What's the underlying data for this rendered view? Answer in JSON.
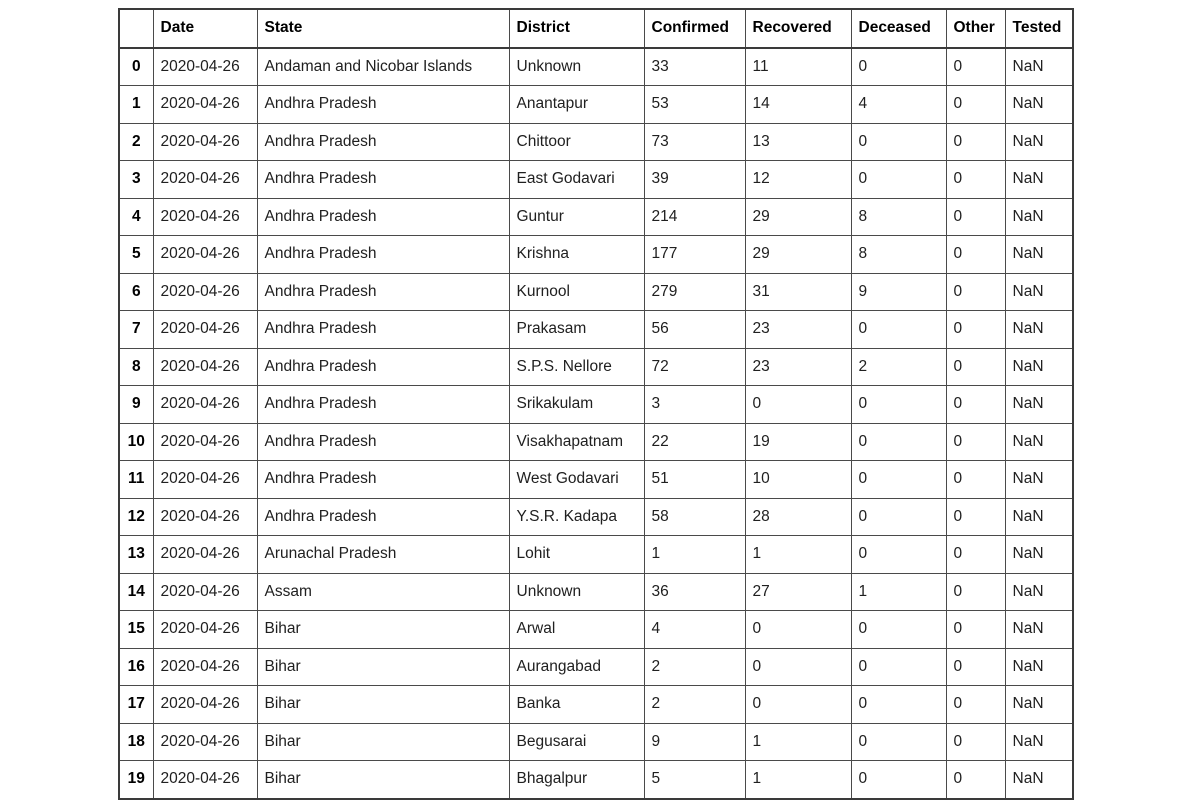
{
  "table": {
    "index_header": "",
    "columns": [
      "Date",
      "State",
      "District",
      "Confirmed",
      "Recovered",
      "Deceased",
      "Other",
      "Tested"
    ],
    "rows": [
      {
        "index": "0",
        "Date": "2020-04-26",
        "State": "Andaman and Nicobar Islands",
        "District": "Unknown",
        "Confirmed": "33",
        "Recovered": "11",
        "Deceased": "0",
        "Other": "0",
        "Tested": "NaN"
      },
      {
        "index": "1",
        "Date": "2020-04-26",
        "State": "Andhra Pradesh",
        "District": "Anantapur",
        "Confirmed": "53",
        "Recovered": "14",
        "Deceased": "4",
        "Other": "0",
        "Tested": "NaN"
      },
      {
        "index": "2",
        "Date": "2020-04-26",
        "State": "Andhra Pradesh",
        "District": "Chittoor",
        "Confirmed": "73",
        "Recovered": "13",
        "Deceased": "0",
        "Other": "0",
        "Tested": "NaN"
      },
      {
        "index": "3",
        "Date": "2020-04-26",
        "State": "Andhra Pradesh",
        "District": "East Godavari",
        "Confirmed": "39",
        "Recovered": "12",
        "Deceased": "0",
        "Other": "0",
        "Tested": "NaN"
      },
      {
        "index": "4",
        "Date": "2020-04-26",
        "State": "Andhra Pradesh",
        "District": "Guntur",
        "Confirmed": "214",
        "Recovered": "29",
        "Deceased": "8",
        "Other": "0",
        "Tested": "NaN"
      },
      {
        "index": "5",
        "Date": "2020-04-26",
        "State": "Andhra Pradesh",
        "District": "Krishna",
        "Confirmed": "177",
        "Recovered": "29",
        "Deceased": "8",
        "Other": "0",
        "Tested": "NaN"
      },
      {
        "index": "6",
        "Date": "2020-04-26",
        "State": "Andhra Pradesh",
        "District": "Kurnool",
        "Confirmed": "279",
        "Recovered": "31",
        "Deceased": "9",
        "Other": "0",
        "Tested": "NaN"
      },
      {
        "index": "7",
        "Date": "2020-04-26",
        "State": "Andhra Pradesh",
        "District": "Prakasam",
        "Confirmed": "56",
        "Recovered": "23",
        "Deceased": "0",
        "Other": "0",
        "Tested": "NaN"
      },
      {
        "index": "8",
        "Date": "2020-04-26",
        "State": "Andhra Pradesh",
        "District": "S.P.S. Nellore",
        "Confirmed": "72",
        "Recovered": "23",
        "Deceased": "2",
        "Other": "0",
        "Tested": "NaN"
      },
      {
        "index": "9",
        "Date": "2020-04-26",
        "State": "Andhra Pradesh",
        "District": "Srikakulam",
        "Confirmed": "3",
        "Recovered": "0",
        "Deceased": "0",
        "Other": "0",
        "Tested": "NaN"
      },
      {
        "index": "10",
        "Date": "2020-04-26",
        "State": "Andhra Pradesh",
        "District": "Visakhapatnam",
        "Confirmed": "22",
        "Recovered": "19",
        "Deceased": "0",
        "Other": "0",
        "Tested": "NaN"
      },
      {
        "index": "11",
        "Date": "2020-04-26",
        "State": "Andhra Pradesh",
        "District": "West Godavari",
        "Confirmed": "51",
        "Recovered": "10",
        "Deceased": "0",
        "Other": "0",
        "Tested": "NaN"
      },
      {
        "index": "12",
        "Date": "2020-04-26",
        "State": "Andhra Pradesh",
        "District": "Y.S.R. Kadapa",
        "Confirmed": "58",
        "Recovered": "28",
        "Deceased": "0",
        "Other": "0",
        "Tested": "NaN"
      },
      {
        "index": "13",
        "Date": "2020-04-26",
        "State": "Arunachal Pradesh",
        "District": "Lohit",
        "Confirmed": "1",
        "Recovered": "1",
        "Deceased": "0",
        "Other": "0",
        "Tested": "NaN"
      },
      {
        "index": "14",
        "Date": "2020-04-26",
        "State": "Assam",
        "District": "Unknown",
        "Confirmed": "36",
        "Recovered": "27",
        "Deceased": "1",
        "Other": "0",
        "Tested": "NaN"
      },
      {
        "index": "15",
        "Date": "2020-04-26",
        "State": "Bihar",
        "District": "Arwal",
        "Confirmed": "4",
        "Recovered": "0",
        "Deceased": "0",
        "Other": "0",
        "Tested": "NaN"
      },
      {
        "index": "16",
        "Date": "2020-04-26",
        "State": "Bihar",
        "District": "Aurangabad",
        "Confirmed": "2",
        "Recovered": "0",
        "Deceased": "0",
        "Other": "0",
        "Tested": "NaN"
      },
      {
        "index": "17",
        "Date": "2020-04-26",
        "State": "Bihar",
        "District": "Banka",
        "Confirmed": "2",
        "Recovered": "0",
        "Deceased": "0",
        "Other": "0",
        "Tested": "NaN"
      },
      {
        "index": "18",
        "Date": "2020-04-26",
        "State": "Bihar",
        "District": "Begusarai",
        "Confirmed": "9",
        "Recovered": "1",
        "Deceased": "0",
        "Other": "0",
        "Tested": "NaN"
      },
      {
        "index": "19",
        "Date": "2020-04-26",
        "State": "Bihar",
        "District": "Bhagalpur",
        "Confirmed": "5",
        "Recovered": "1",
        "Deceased": "0",
        "Other": "0",
        "Tested": "NaN"
      }
    ]
  },
  "colors": {
    "border": "#4a4a4a",
    "outer_border": "#3a3a3a",
    "text": "#202020",
    "background": "#ffffff"
  }
}
